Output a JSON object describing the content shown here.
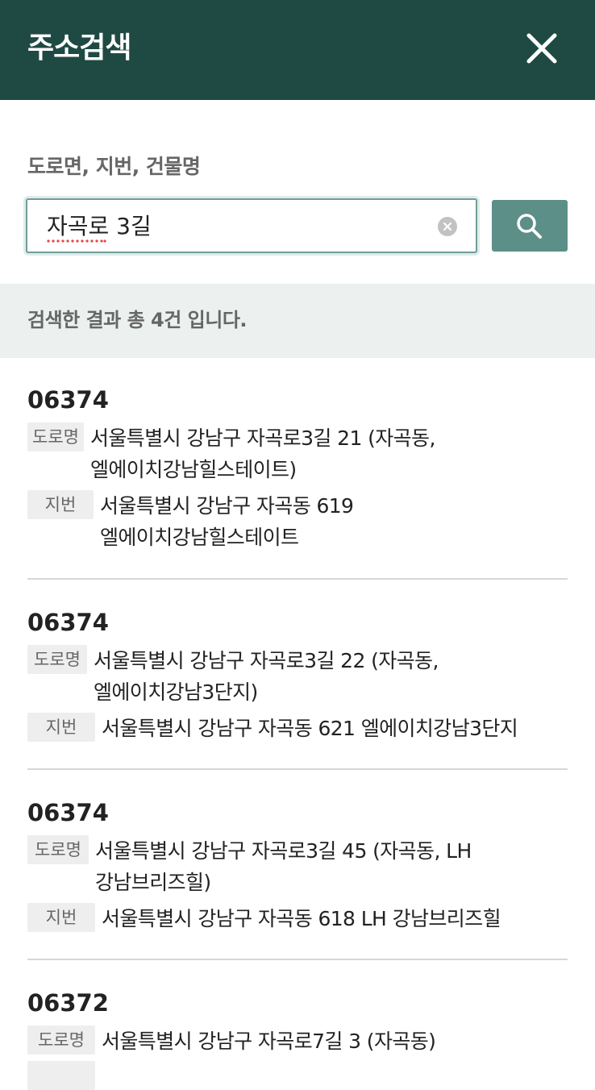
{
  "header": {
    "title": "주소검색",
    "close_icon": "close-icon"
  },
  "search": {
    "label": "도로면, 지번, 건물명",
    "value": "자곡로 3길",
    "clear_icon": "clear-circle-x-icon",
    "button_icon": "search-icon"
  },
  "colors": {
    "header_bg": "#1f4a43",
    "search_button_bg": "#5b8f88",
    "result_bar_bg": "#ecf0ef"
  },
  "result_summary": "검색한 결과 총 4건 입니다.",
  "tags": {
    "road": "도로명",
    "lot": "지번"
  },
  "results": [
    {
      "zip": "06374",
      "road_line1": "서울특별시 강남구 자곡로3길 21 (자곡동,",
      "road_line2": "엘에이치강남힐스테이트)",
      "lot_line1": "서울특별시 강남구 자곡동 619",
      "lot_line2": "엘에이치강남힐스테이트"
    },
    {
      "zip": "06374",
      "road_line1": "서울특별시 강남구 자곡로3길 22 (자곡동,",
      "road_line2": "엘에이치강남3단지)",
      "lot_line1": "서울특별시 강남구 자곡동 621 엘에이치강남3단지"
    },
    {
      "zip": "06374",
      "road_line1": "서울특별시 강남구 자곡로3길 45 (자곡동, LH",
      "road_line2": "강남브리즈힐)",
      "lot_line1": "서울특별시 강남구 자곡동 618 LH 강남브리즈힐"
    },
    {
      "zip": "06372",
      "road_line1": "서울특별시 강남구 자곡로7길 3 (자곡동)"
    }
  ]
}
